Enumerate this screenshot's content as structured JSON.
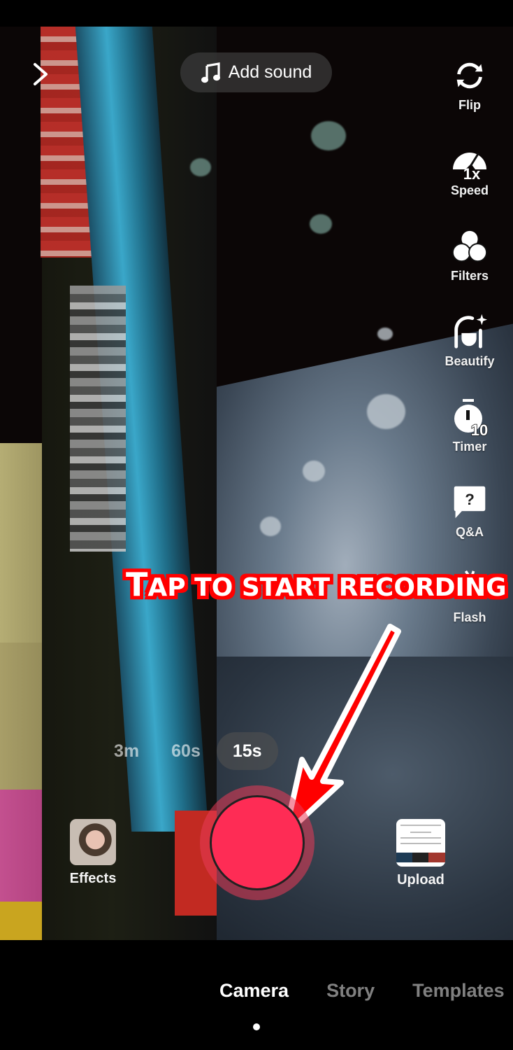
{
  "top": {
    "add_sound_label": "Add sound"
  },
  "rail": {
    "flip": "Flip",
    "speed": "Speed",
    "speed_value": "1x",
    "filters": "Filters",
    "beautify": "Beautify",
    "timer": "Timer",
    "timer_value": "10",
    "qa": "Q&A",
    "flash": "Flash"
  },
  "annotation": {
    "first_letter": "T",
    "rest": "AP TO START RECORDING",
    "color": "#ff0000"
  },
  "durations": [
    {
      "label": "3m",
      "selected": false
    },
    {
      "label": "60s",
      "selected": false
    },
    {
      "label": "15s",
      "selected": true
    }
  ],
  "bottom": {
    "effects_label": "Effects",
    "upload_label": "Upload",
    "record_color": "#fe2c55"
  },
  "modes": [
    {
      "label": "Camera",
      "selected": true
    },
    {
      "label": "Story",
      "selected": false
    },
    {
      "label": "Templates",
      "selected": false
    }
  ],
  "icons": {
    "close": "chevron-right-icon",
    "music": "music-note-icon",
    "flip": "flip-camera-icon",
    "speed": "speedometer-icon",
    "filters": "filters-icon",
    "beautify": "beautify-face-icon",
    "timer": "timer-icon",
    "qa": "question-bubble-icon",
    "flash": "flash-off-icon"
  }
}
